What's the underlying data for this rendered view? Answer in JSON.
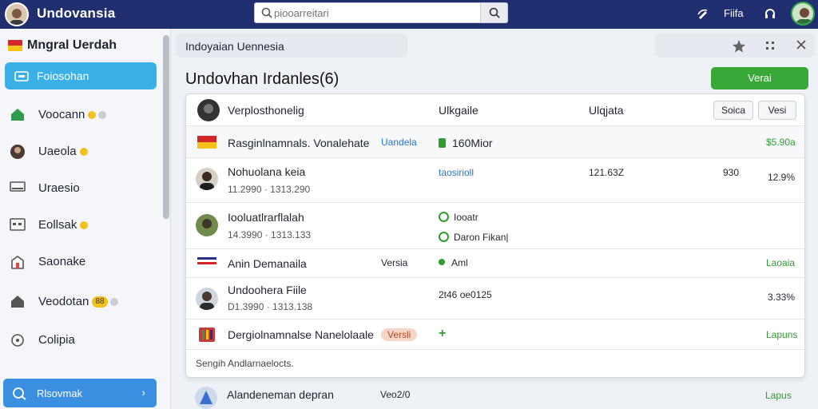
{
  "topbar": {
    "app_title": "Undovansia",
    "search_placeholder": "piooarreitari",
    "right_label": "Fiifa"
  },
  "sidebar": {
    "brand": "Mngral Uerdah",
    "active_item": "Foiosohan",
    "items": [
      {
        "label": "Voocann",
        "icon": "home-icon"
      },
      {
        "label": "Uaeola",
        "icon": "user-icon"
      },
      {
        "label": "Uraesio",
        "icon": "monitor-icon"
      },
      {
        "label": "Eollsak",
        "icon": "calendar-icon"
      },
      {
        "label": "Saonake",
        "icon": "building-icon"
      },
      {
        "label": "Veodotan",
        "icon": "house-icon",
        "badge": "88"
      },
      {
        "label": "Colipia",
        "icon": "clock-icon"
      }
    ],
    "bottom_item": "Rlsovmak"
  },
  "main": {
    "breadcrumb": "Indoyaian Uennesia",
    "page_title": "Undovhan Irdanles(6)",
    "primary_button": "Verai"
  },
  "table": {
    "headers": [
      "Verplosthonelig",
      "Ulkgaile",
      "Ulqjata"
    ],
    "header_buttons": [
      "Soica",
      "Vesi"
    ],
    "rows": [
      {
        "name": "Rasginlnamnals. Vonalehate",
        "tag": "Uandela",
        "status": "160Mior",
        "value": "$5.90a"
      },
      {
        "name": "Nohuolana keia",
        "sub": "11.2990 · 1313.290",
        "link": "taosirioll",
        "col3": "121.63Z",
        "col4": "930",
        "value": "12.9%"
      },
      {
        "name": "Iooluatlrarflalah",
        "sub": "14.3990 · 1313.133",
        "status": "Iooatr",
        "status2": "Daron Fikan|"
      },
      {
        "name": "Anin Demanaila",
        "tag": "Versia",
        "status": "Aml",
        "value": "Laoaia"
      },
      {
        "name": "Undoohera Fiile",
        "sub": "D1.3990 · 1313.138",
        "link": "2t46 oe0125",
        "value": "3.33%"
      },
      {
        "name": "Dergiolnamnalse Nanelolaale",
        "tag": "Versli",
        "status": "+",
        "value": "Lapuns"
      }
    ],
    "footer": "Sengih Andlarnaelocts."
  },
  "below_row": {
    "name": "Alandeneman depran",
    "sub": "Veo2/0",
    "value": "Lapus"
  }
}
